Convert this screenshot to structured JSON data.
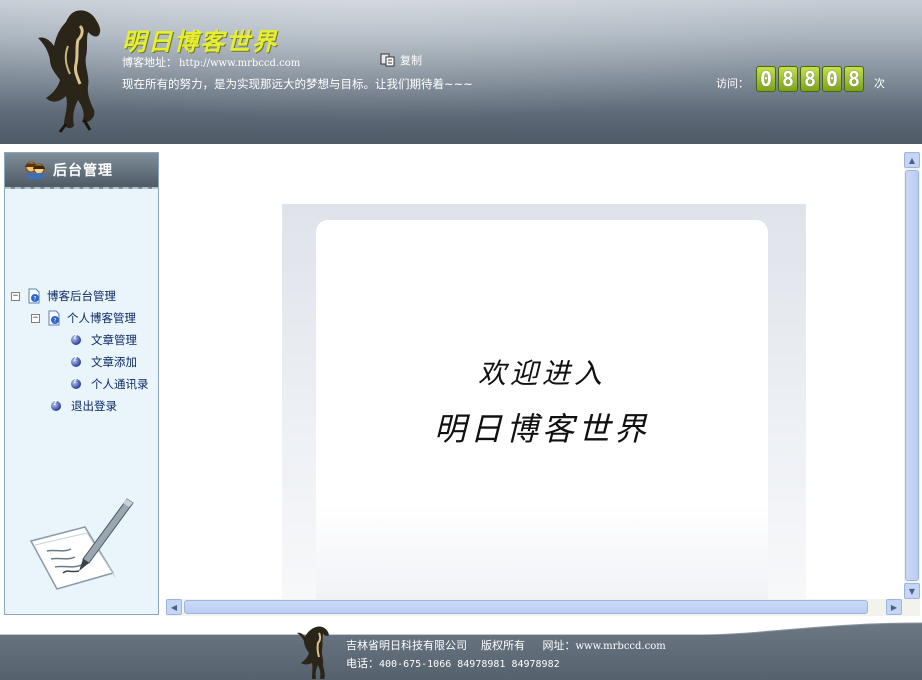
{
  "header": {
    "blog_title": "明日博客世界",
    "address_label": "博客地址：",
    "address_url": "http://www.mrbccd.com",
    "copy_label": "复制",
    "motto": "现在所有的努力，是为实现那远大的梦想与目标。让我们期待着~~~",
    "visit_label": "访问：",
    "visit_digits": [
      "0",
      "8",
      "8",
      "0",
      "8"
    ],
    "visit_unit": "次"
  },
  "sidebar": {
    "title": "后台管理",
    "tree": {
      "root": {
        "label": "博客后台管理",
        "toggle": "−"
      },
      "group": {
        "label": "个人博客管理",
        "toggle": "−"
      },
      "items": [
        {
          "label": "文章管理"
        },
        {
          "label": "文章添加"
        },
        {
          "label": "个人通讯录"
        }
      ],
      "logout": {
        "label": "退出登录"
      }
    }
  },
  "main": {
    "welcome_line1": "欢迎进入",
    "welcome_line2": "明日博客世界"
  },
  "footer": {
    "company": "吉林省明日科技有限公司",
    "rights": "版权所有",
    "site_label": "网址：",
    "site_url": "www.mrbccd.com",
    "phone_label": "电话：",
    "phone_numbers": "400-675-1066  84978981 84978982"
  },
  "colors": {
    "title_yellow": "#e6ee2f",
    "counter_green": "#8fb521",
    "tree_text": "#0c2a66"
  }
}
